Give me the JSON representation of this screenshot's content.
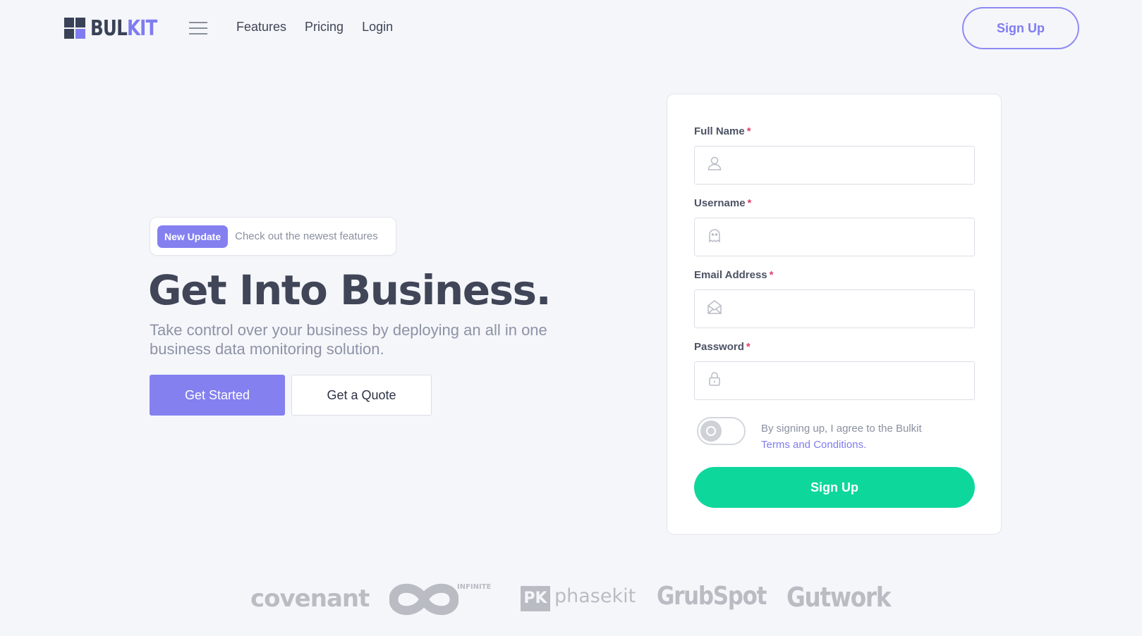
{
  "nav": {
    "logo_part1": "BUL",
    "logo_part2": "KIT",
    "links": [
      "Features",
      "Pricing",
      "Login"
    ],
    "signup_label": "Sign Up"
  },
  "hero": {
    "badge": "New Update",
    "badge_text": "Check out the newest features",
    "title": "Get Into Business.",
    "subtitle": "Take control over your business by deploying an all in one business data monitoring solution.",
    "primary_cta": "Get Started",
    "secondary_cta": "Get a Quote"
  },
  "form": {
    "fields": [
      {
        "label": "Full Name",
        "required_mark": "*",
        "icon": "user-icon"
      },
      {
        "label": "Username",
        "required_mark": "*",
        "icon": "ghost-icon"
      },
      {
        "label": "Email Address",
        "required_mark": "*",
        "icon": "envelope-icon"
      },
      {
        "label": "Password",
        "required_mark": "*",
        "icon": "lock-icon"
      }
    ],
    "terms_text": "By signing up, I agree to the Bulkit",
    "terms_link": "Terms and Conditions.",
    "submit_label": "Sign Up",
    "agree_toggle_on": false
  },
  "partners": {
    "covenant": "covenant",
    "infinite": "INFINITE",
    "phasekit_mark": "PK",
    "phasekit": "phasekit",
    "grubspot": "GrubSpot",
    "gutwork": "Gutwork"
  },
  "colors": {
    "accent": "#8480f0",
    "success": "#0ed79c",
    "required": "#e0406b",
    "background": "#f5f6fa"
  }
}
